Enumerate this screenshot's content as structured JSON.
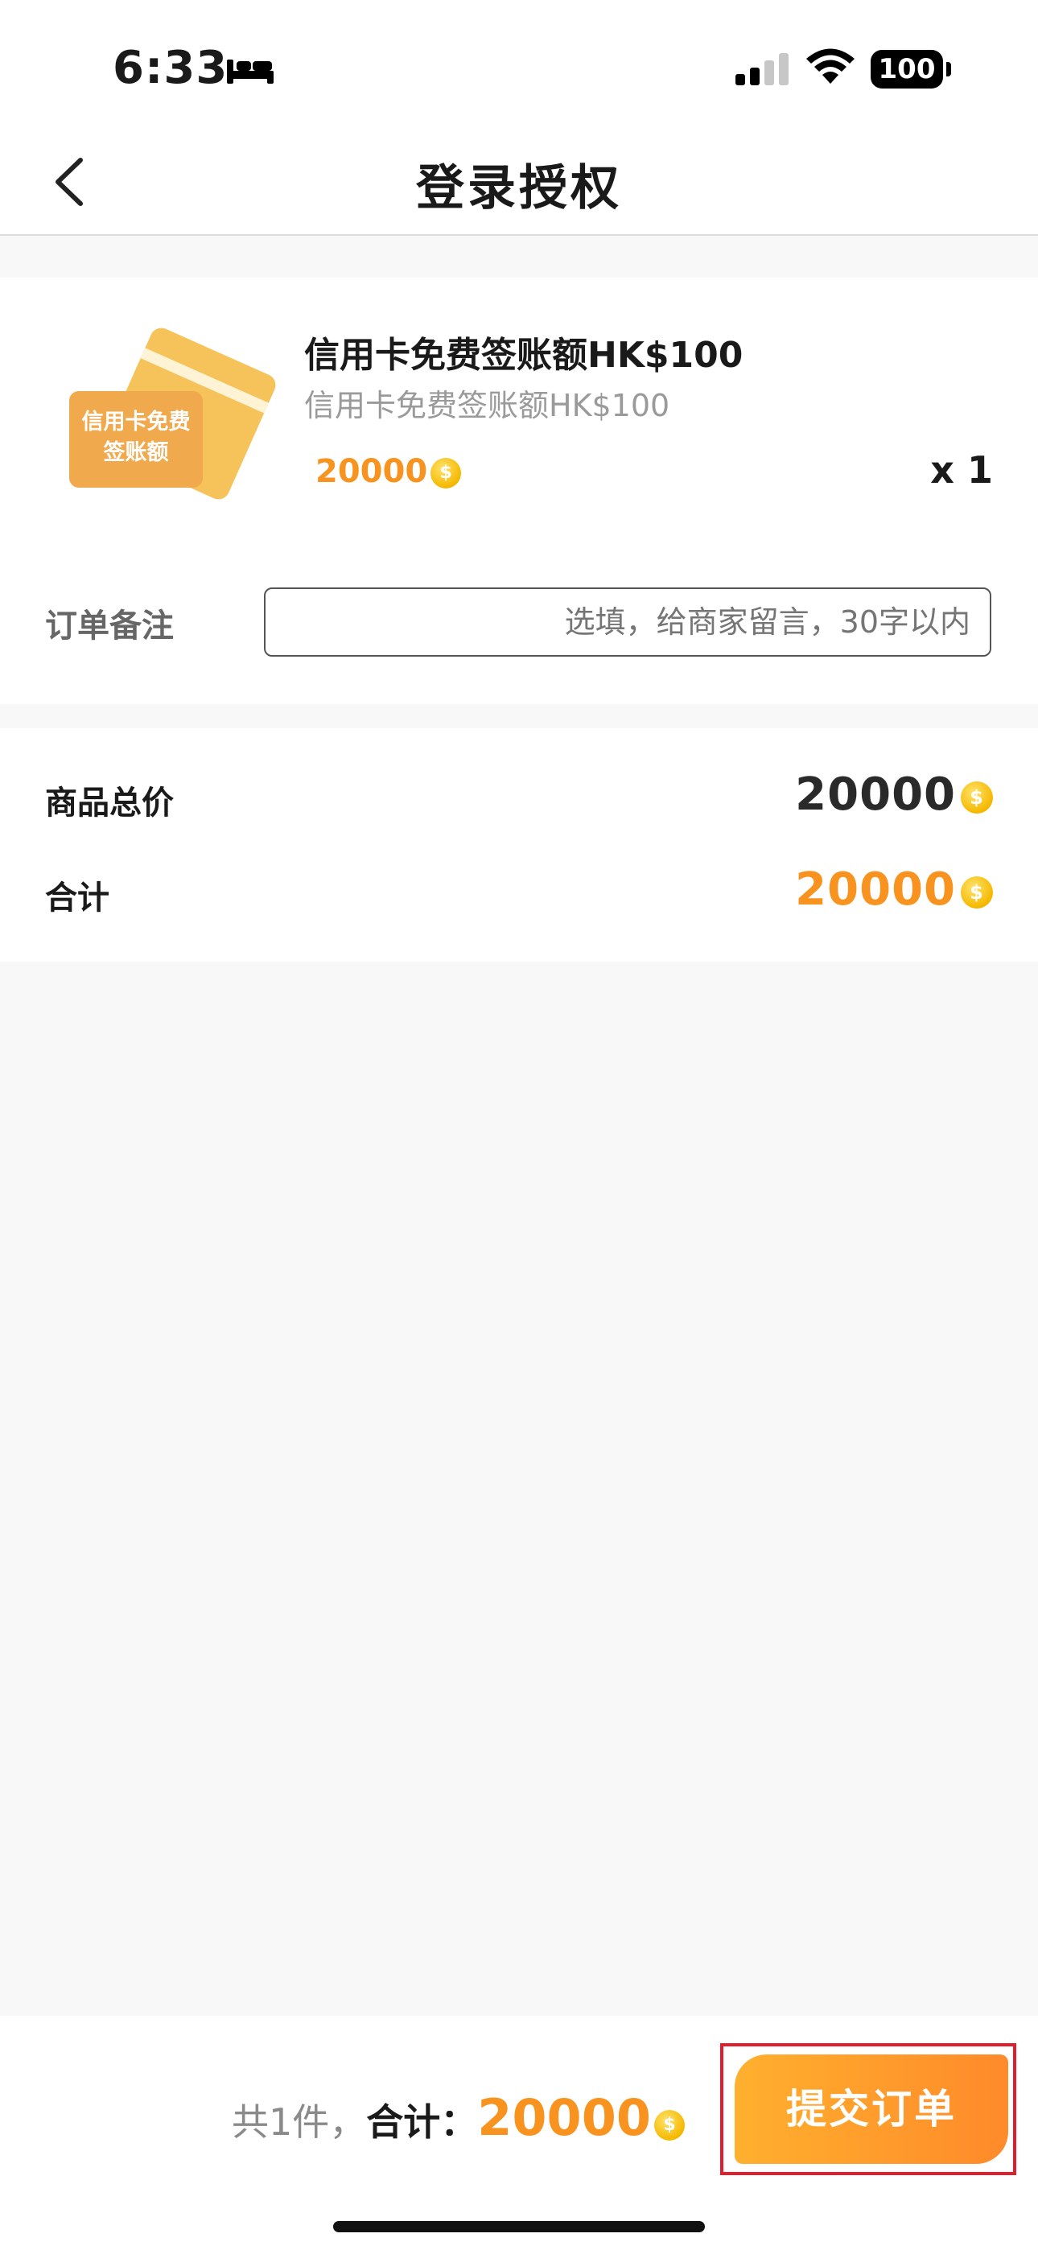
{
  "status_bar": {
    "time": "6:33",
    "battery": "100",
    "icons": [
      "bed-icon",
      "cellular-signal-icon",
      "wifi-icon",
      "battery-icon"
    ]
  },
  "nav": {
    "title": "登录授权",
    "back_icon": "chevron-left-icon"
  },
  "product": {
    "image_text_line1": "信用卡免费",
    "image_text_line2": "签账额",
    "title": "信用卡免费签账额HK$100",
    "subtitle": "信用卡免费签账额HK$100",
    "price": "20000",
    "quantity": "x 1",
    "coin_glyph": "$"
  },
  "note": {
    "label": "订单备注",
    "placeholder": "选填，给商家留言，30字以内"
  },
  "summary": {
    "subtotal_label": "商品总价",
    "subtotal_value": "20000",
    "total_label": "合计",
    "total_value": "20000"
  },
  "bottom_bar": {
    "count_text": "共1件，",
    "total_label": "合计：",
    "total_value": "20000",
    "submit_label": "提交订单"
  },
  "colors": {
    "accent_orange": "#f7931e",
    "coin_gold": "#f5b800",
    "highlight_red": "#e01e2d"
  }
}
